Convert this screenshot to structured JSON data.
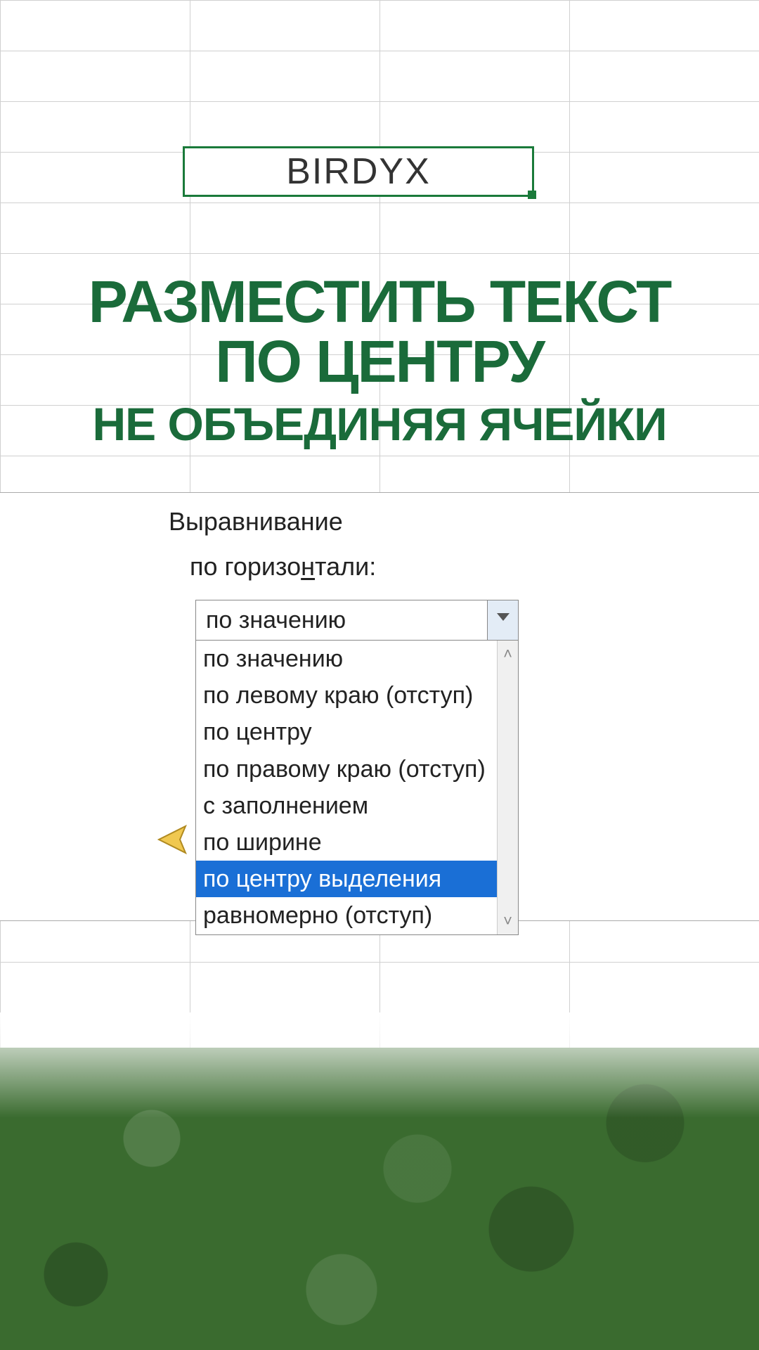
{
  "topcell": {
    "text": "BIRDYX"
  },
  "heading": {
    "line1": "РАЗМЕСТИТЬ ТЕКСТ",
    "line2": "ПО ЦЕНТРУ",
    "line3": "НЕ ОБЪЕДИНЯЯ ЯЧЕЙКИ"
  },
  "dialog": {
    "section_title": "Выравнивание",
    "horiz_label_pre": "по горизо",
    "horiz_label_u": "н",
    "horiz_label_post": "тали:",
    "combo_value": "по значению",
    "options": [
      "по значению",
      "по левому краю (отступ)",
      "по центру",
      "по правому краю (отступ)",
      "с заполнением",
      "по ширине",
      "по центру выделения",
      "равномерно (отступ)"
    ],
    "highlight_index": 6
  },
  "colors": {
    "accent_green": "#1a6b3a",
    "cell_border_green": "#1a7a3a",
    "highlight_blue": "#1a6fd6",
    "footer_green": "#3a6b2f"
  }
}
